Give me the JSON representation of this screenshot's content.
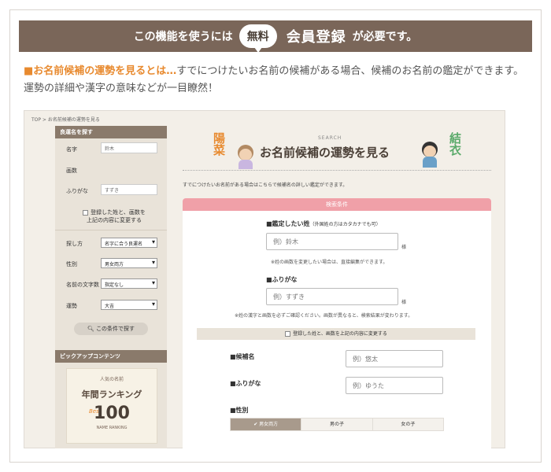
{
  "banner": {
    "pre": "この機能を使うには",
    "free": "無料",
    "main": "会員登録",
    "post": "が必要です。"
  },
  "intro": {
    "highlight": "■お名前候補の運勢を見るとは…",
    "text": "すでにつけたいお名前の候補がある場合、候補のお名前の鑑定ができます。運勢の詳細や漢字の意味などが一目瞭然！"
  },
  "shot": {
    "breadcrumb": "TOP > お名前候補の運勢を見る",
    "sidebar": {
      "head": "良運名を探す",
      "surname_label": "名字",
      "surname_value": "鈴木",
      "strokes_label": "画数",
      "furigana_label": "ふりがな",
      "furigana_value": "すずき",
      "checkbox_label_1": "登録した姓と、画数を",
      "checkbox_label_2": "上記の内容に変更する",
      "selects": [
        {
          "label": "探し方",
          "value": "名字に合う良運名"
        },
        {
          "label": "性別",
          "value": "男女両方"
        },
        {
          "label": "名前の文字数",
          "value": "指定なし"
        },
        {
          "label": "運勢",
          "value": "大吉"
        }
      ],
      "search_button": "この条件で探す",
      "pickup_head": "ピックアップコンテンツ",
      "ranking": {
        "top": "人気の名前",
        "title": "年間ランキング",
        "best": "Best",
        "number": "100",
        "sub": "NAME RANKING"
      }
    },
    "main": {
      "search_small": "SEARCH",
      "title": "お名前候補の運勢を見る",
      "deco_left": "陽菜",
      "deco_right": "結衣",
      "description": "すでにつけたいお名前がある場合はこちらで候補名の詳しい鑑定ができます。",
      "panel_head": "検索条件",
      "surname_label": "■鑑定したい姓",
      "surname_note_small": "（外国姓の方はカタカナでも可）",
      "surname_placeholder": "例）鈴木",
      "sama": "様",
      "surname_note": "※姓の画数を変更したい場合は、直接編集ができます。",
      "furigana_label": "■ふりがな",
      "furigana_placeholder": "例）すずき",
      "kanji_note": "※姓の漢字と画数を必ずご確認ください。画数が異なると、検索結果が変わります。",
      "check_label": "登録した姓と、画数を上記の内容に変更する",
      "candidate_label": "■候補名",
      "candidate_placeholder": "例）悠太",
      "candidate_furigana_label": "■ふりがな",
      "candidate_furigana_placeholder": "例）ゆうた",
      "gender_label": "■性別",
      "gender_options": [
        "✔ 男女両方",
        "男の子",
        "女の子"
      ]
    }
  }
}
